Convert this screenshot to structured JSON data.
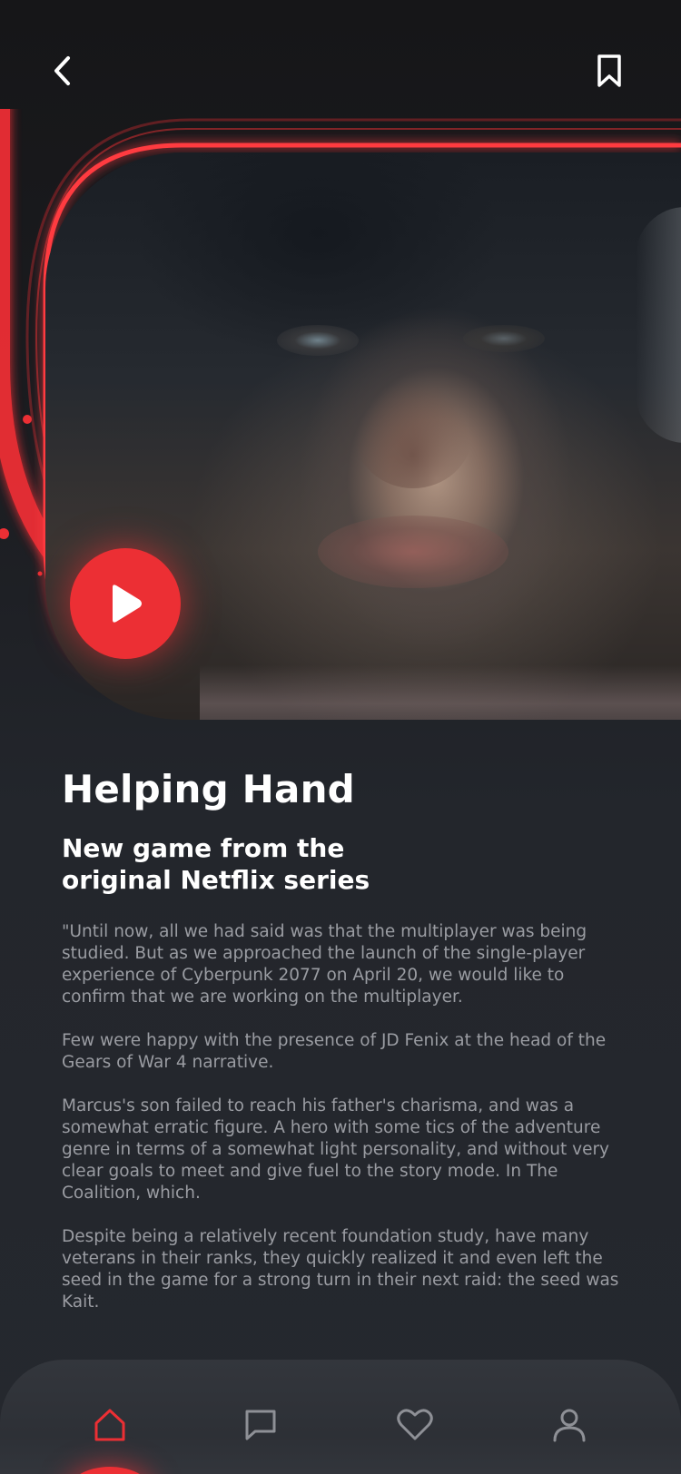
{
  "header": {
    "back_icon": "chevron-left-icon",
    "bookmark_icon": "bookmark-icon"
  },
  "hero": {
    "play_icon": "play-icon"
  },
  "article": {
    "title": "Helping Hand",
    "subtitle": "New game from the original Netflix series",
    "paragraphs": [
      "\"Until now, all we had said was that the multiplayer was being studied. But as we approached the launch of the single-player experience of Cyberpunk 2077 on April 20, we would like to confirm that we are working on the multiplayer.",
      "Few were happy with the presence of JD Fenix at the head of the Gears of War 4 narrative.",
      "Marcus's son failed to reach his father's charisma, and was a somewhat erratic figure. A hero with some tics of the adventure genre in terms of a somewhat light personality, and without very clear goals to meet and give fuel to the story mode. In The Coalition, which.",
      "Despite being a relatively recent foundation study, have many veterans in their ranks, they quickly realized it and even left the seed in the game for a strong turn in their next raid: the seed was Kait."
    ]
  },
  "bottom_nav": {
    "items": [
      {
        "icon": "home-icon",
        "active": true
      },
      {
        "icon": "chat-icon",
        "active": false
      },
      {
        "icon": "heart-icon",
        "active": false
      },
      {
        "icon": "profile-icon",
        "active": false
      }
    ]
  },
  "colors": {
    "accent": "#ec2f34",
    "background": "#25282e",
    "body_text": "#9a9ca2",
    "nav_icon": "#8e9096"
  }
}
